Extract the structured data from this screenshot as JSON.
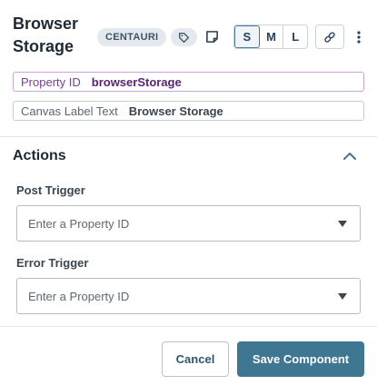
{
  "header": {
    "title": "Browser Storage",
    "badge": "CENTAURI",
    "sizes": [
      "S",
      "M",
      "L"
    ],
    "active_size": "S"
  },
  "fields": {
    "property_id": {
      "label": "Property ID",
      "value": "browserStorage"
    },
    "canvas_label": {
      "label": "Canvas Label Text",
      "value": "Browser Storage"
    }
  },
  "actions": {
    "title": "Actions",
    "post_trigger": {
      "label": "Post Trigger",
      "placeholder": "Enter a Property ID"
    },
    "error_trigger": {
      "label": "Error Trigger",
      "placeholder": "Enter a Property ID"
    }
  },
  "footer": {
    "cancel": "Cancel",
    "save": "Save Component"
  },
  "icons": [
    "tag-icon",
    "note-icon",
    "link-icon",
    "more-vertical-icon",
    "chevron-up-icon",
    "caret-down-icon"
  ],
  "colors": {
    "accent": "#3f7792",
    "property_purple": "#7b3e96"
  }
}
